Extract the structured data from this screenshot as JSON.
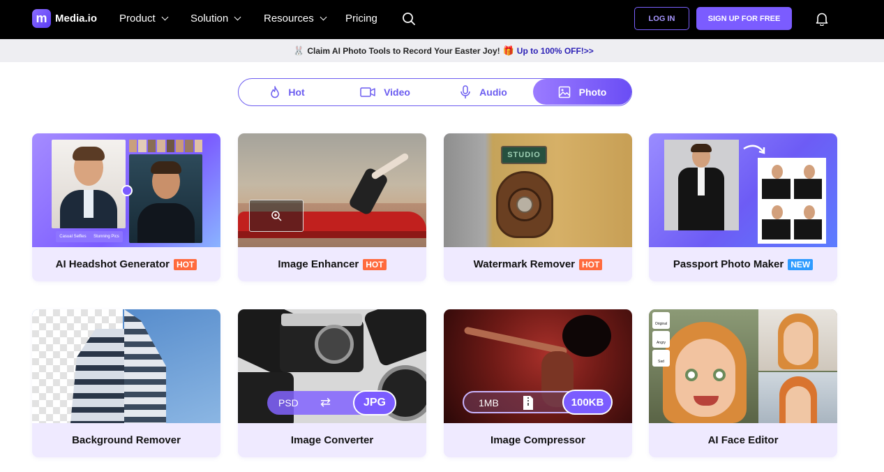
{
  "brand": {
    "name": "Media.io",
    "mark": "m"
  },
  "nav": {
    "items": [
      {
        "label": "Product",
        "dropdown": true
      },
      {
        "label": "Solution",
        "dropdown": true
      },
      {
        "label": "Resources",
        "dropdown": true
      },
      {
        "label": "Pricing",
        "dropdown": false
      }
    ],
    "login": "LOG IN",
    "signup": "SIGN UP FOR FREE"
  },
  "promo": {
    "text": "Claim AI Photo Tools to Record Your Easter Joy!",
    "offer": "Up to 100% OFF!>>"
  },
  "tabs": [
    {
      "label": "Hot",
      "icon": "flame-icon",
      "active": false
    },
    {
      "label": "Video",
      "icon": "video-icon",
      "active": false
    },
    {
      "label": "Audio",
      "icon": "microphone-icon",
      "active": false
    },
    {
      "label": "Photo",
      "icon": "image-icon",
      "active": true
    }
  ],
  "cards": [
    {
      "title": "AI Headshot Generator",
      "badge": "HOT",
      "overlay": {
        "left": "Casual Selfies",
        "right": "Stunning Pics"
      }
    },
    {
      "title": "Image Enhancer",
      "badge": "HOT"
    },
    {
      "title": "Watermark Remover",
      "badge": "HOT",
      "sign": "STUDIO"
    },
    {
      "title": "Passport Photo Maker",
      "badge": "NEW"
    },
    {
      "title": "Background Remover",
      "badge": ""
    },
    {
      "title": "Image Converter",
      "badge": "",
      "pill": {
        "from": "PSD",
        "to": "JPG"
      }
    },
    {
      "title": "Image Compressor",
      "badge": "",
      "pill": {
        "from": "1MB",
        "to": "100KB"
      }
    },
    {
      "title": "AI Face Editor",
      "badge": "",
      "side": [
        "Original",
        "Angry",
        "Sad"
      ]
    }
  ],
  "colors": {
    "accent": "#7b5cff",
    "hot": "#ff6a3d",
    "new": "#2e9bff",
    "card_bg": "#efeaff"
  }
}
